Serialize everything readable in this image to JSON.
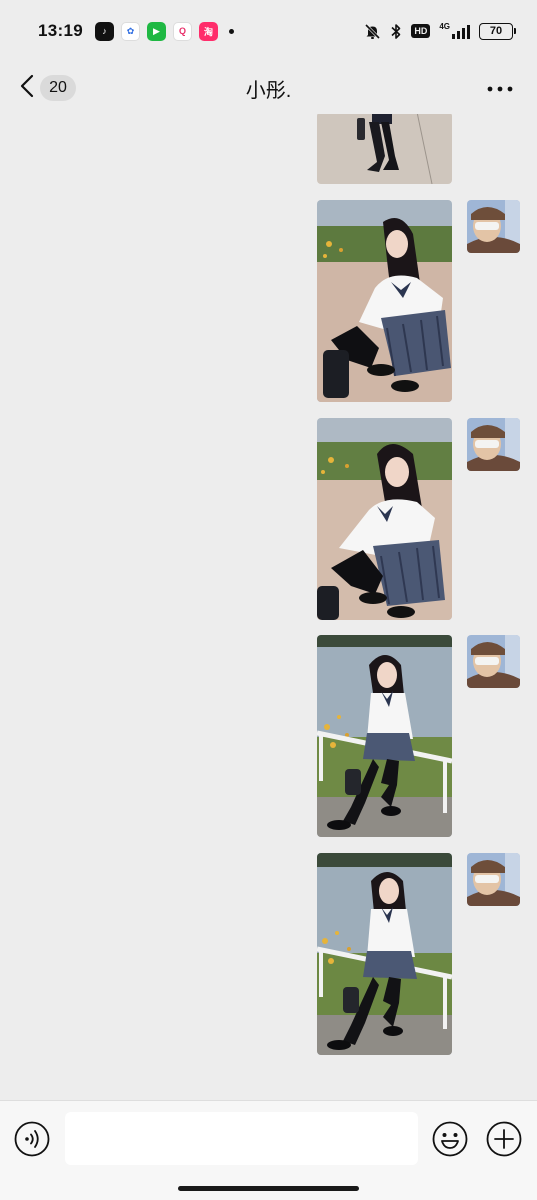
{
  "status_bar": {
    "time": "13:19",
    "apps": [
      {
        "name": "douyin-app-icon",
        "glyph": "♪",
        "color": "#111111"
      },
      {
        "name": "baidu-app-icon",
        "glyph": "✿",
        "color": "#2f6de1"
      },
      {
        "name": "iqiyi-app-icon",
        "glyph": "▶",
        "color": "#1fb843"
      },
      {
        "name": "quark-app-icon",
        "glyph": "Q",
        "color": "#e8306a"
      },
      {
        "name": "taobao-app-icon",
        "glyph": "淘",
        "color": "#ff2d6b"
      }
    ],
    "hd": "HD",
    "network": "4G",
    "battery": "70"
  },
  "nav": {
    "unread_count": "20",
    "title": "小彤."
  },
  "messages": [
    {
      "id": 1,
      "type": "image",
      "sender": "self",
      "partial": true
    },
    {
      "id": 2,
      "type": "image",
      "sender": "self"
    },
    {
      "id": 3,
      "type": "image",
      "sender": "self"
    },
    {
      "id": 4,
      "type": "image",
      "sender": "self"
    },
    {
      "id": 5,
      "type": "image",
      "sender": "self"
    }
  ],
  "input": {
    "value": "",
    "placeholder": ""
  },
  "icons": {
    "back": "chevron-left-icon",
    "more": "more-dots-icon",
    "voice": "voice-icon",
    "emoji": "emoji-icon",
    "plus": "plus-icon"
  },
  "colors": {
    "chat_background": "#ededed",
    "input_bar_background": "#f7f7f7",
    "badge_background": "#dadada"
  }
}
